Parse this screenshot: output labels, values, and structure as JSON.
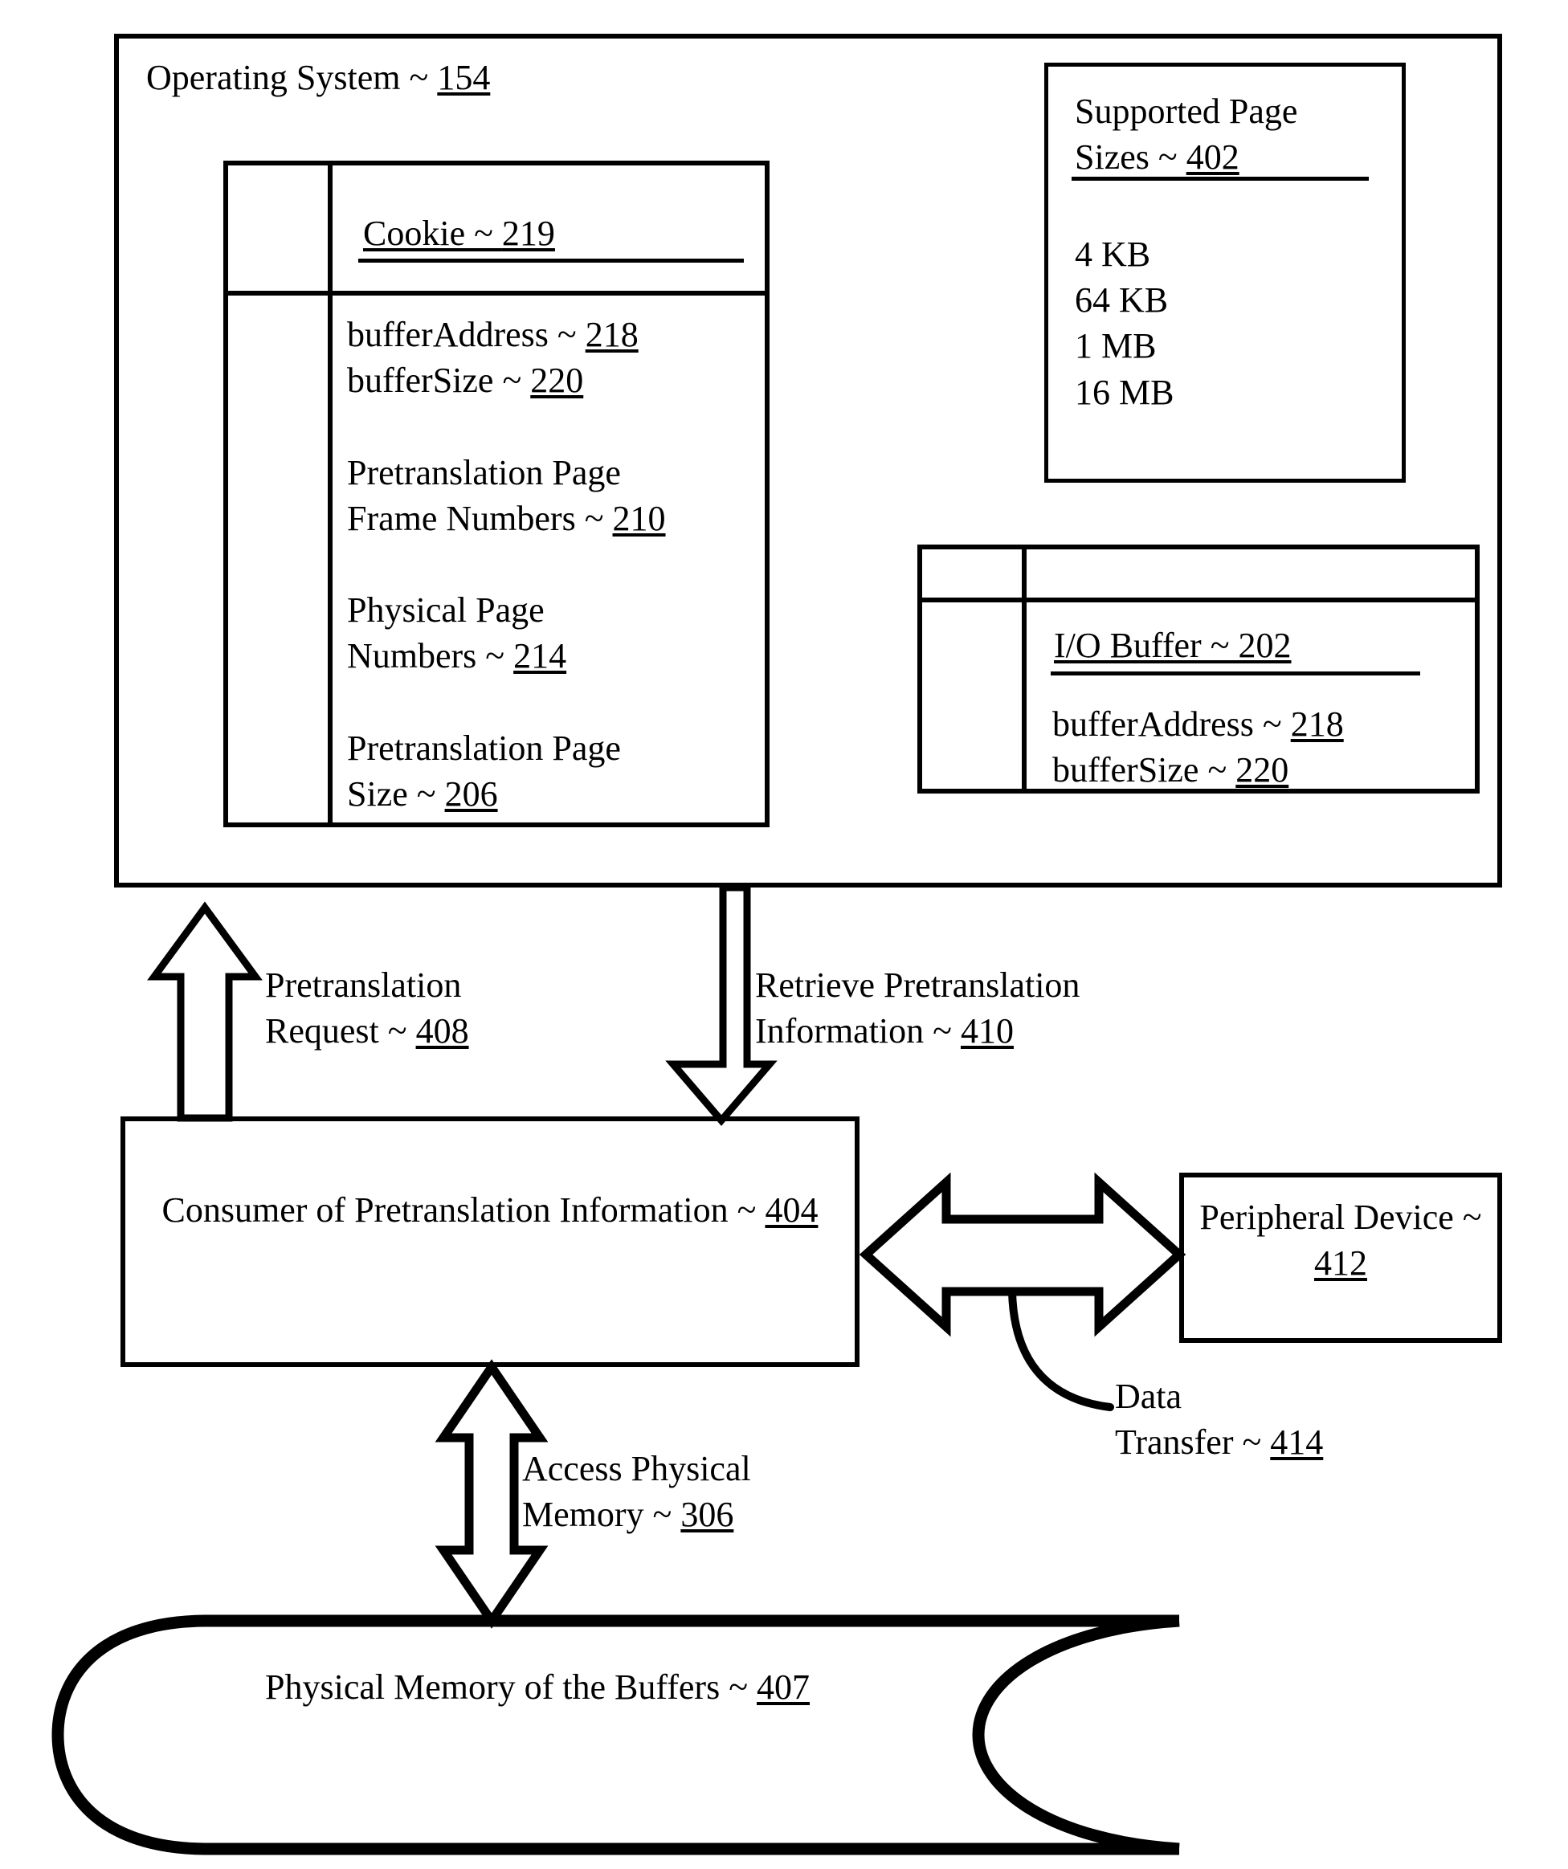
{
  "figure": {
    "os_box": {
      "title": "Operating System ~ 154"
    },
    "pretranslation_table": {
      "caption": "Cookie ~ 219",
      "body": "bufferAddress ~ 218\nbufferSize ~ 220\n\nPretranslation Page\nFrame Numbers ~ 210\n\nPhysical Page\nNumbers ~ 214\n\nPretranslation Page\nSize ~ 206"
    },
    "supported_page_sizes": {
      "title": "Supported Page\nSizes ~ 402",
      "sizes": "4 KB\n64 KB\n1 MB\n16 MB"
    },
    "io_buffer_table": {
      "caption": "I/O Buffer ~ 202",
      "body": "bufferAddress ~ 218\nbufferSize ~ 220"
    },
    "consumer_box": {
      "label": "Consumer of Pretranslation Information ~ 404"
    },
    "peripheral_box": {
      "label": "Peripheral Device ~ 412"
    },
    "arrows": {
      "pretranslation_request": "Pretranslation\nRequest ~ 408",
      "retrieve_pretranslation_information": "Retrieve Pretranslation\nInformation ~ 410",
      "access_physical_memory": "Access Physical\nMemory ~ 306",
      "data_transfer": "Data\nTransfer ~ 414"
    },
    "physical_memory_cylinder": {
      "label": "Physical Memory of the Buffers ~ 407"
    },
    "colors": {
      "ink": "#000000",
      "paper": "#ffffff"
    }
  }
}
